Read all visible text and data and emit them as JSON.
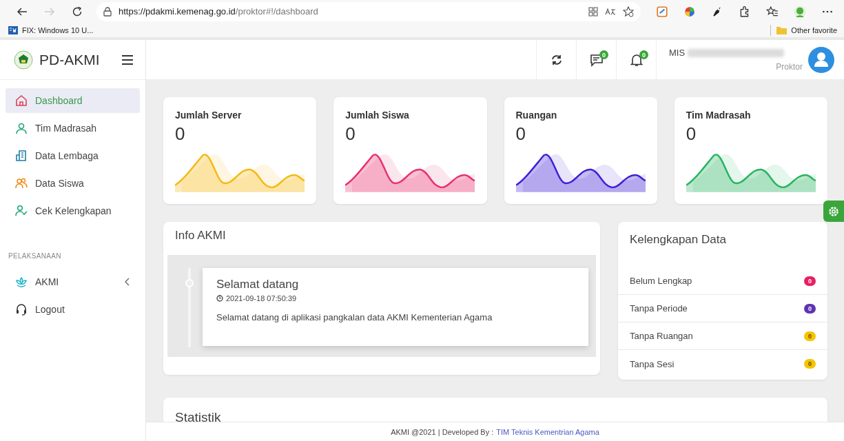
{
  "browser": {
    "url_host": "https://pdakmi.kemenag.go.id",
    "url_path": "/proktor#!/dashboard",
    "bookmarks": [
      {
        "label": "FIX: Windows 10 U..."
      }
    ],
    "other_favorites": "Other favorite"
  },
  "brand": "PD-AKMI",
  "header": {
    "messages_count": "0",
    "notifications_count": "0",
    "user_prefix": "MIS",
    "role": "Proktor"
  },
  "sidebar": {
    "items": [
      {
        "label": "Dashboard",
        "selected": true
      },
      {
        "label": "Tim Madrasah",
        "selected": false
      },
      {
        "label": "Data Lembaga",
        "selected": false
      },
      {
        "label": "Data Siswa",
        "selected": false
      },
      {
        "label": "Cek Kelengkapan",
        "selected": false
      }
    ],
    "section": "PELAKSANAAN",
    "section_items": [
      {
        "label": "AKMI",
        "kind": "submenu",
        "expanded": false
      },
      {
        "label": "Logout",
        "kind": "link"
      }
    ]
  },
  "stats": [
    {
      "title": "Jumlah Server",
      "value": "0",
      "color": "#f5b914"
    },
    {
      "title": "Jumlah Siswa",
      "value": "0",
      "color": "#e8316e"
    },
    {
      "title": "Ruangan",
      "value": "0",
      "color": "#3f1fd6"
    },
    {
      "title": "Tim Madrasah",
      "value": "0",
      "color": "#27b35f"
    }
  ],
  "info": {
    "title": "Info AKMI",
    "entries": [
      {
        "title": "Selamat datang",
        "time": "2021-09-18 07:50:39",
        "message": "Selamat datang di aplikasi pangkalan data AKMI Kementerian Agama"
      }
    ]
  },
  "completeness": {
    "title": "Kelengkapan Data",
    "items": [
      {
        "label": "Belum Lengkap",
        "count": "0",
        "color": "#e91e63"
      },
      {
        "label": "Tanpa Periode",
        "count": "0",
        "color": "#5e35b1"
      },
      {
        "label": "Tanpa Ruangan",
        "count": "0",
        "color": "#f5c400"
      },
      {
        "label": "Tanpa Sesi",
        "count": "0",
        "color": "#f5c400"
      }
    ]
  },
  "statistics": {
    "title": "Statistik"
  },
  "footer": {
    "text": "AKMI @2021 | Developed By :",
    "link": "TIM Teknis Kementrian Agama"
  }
}
